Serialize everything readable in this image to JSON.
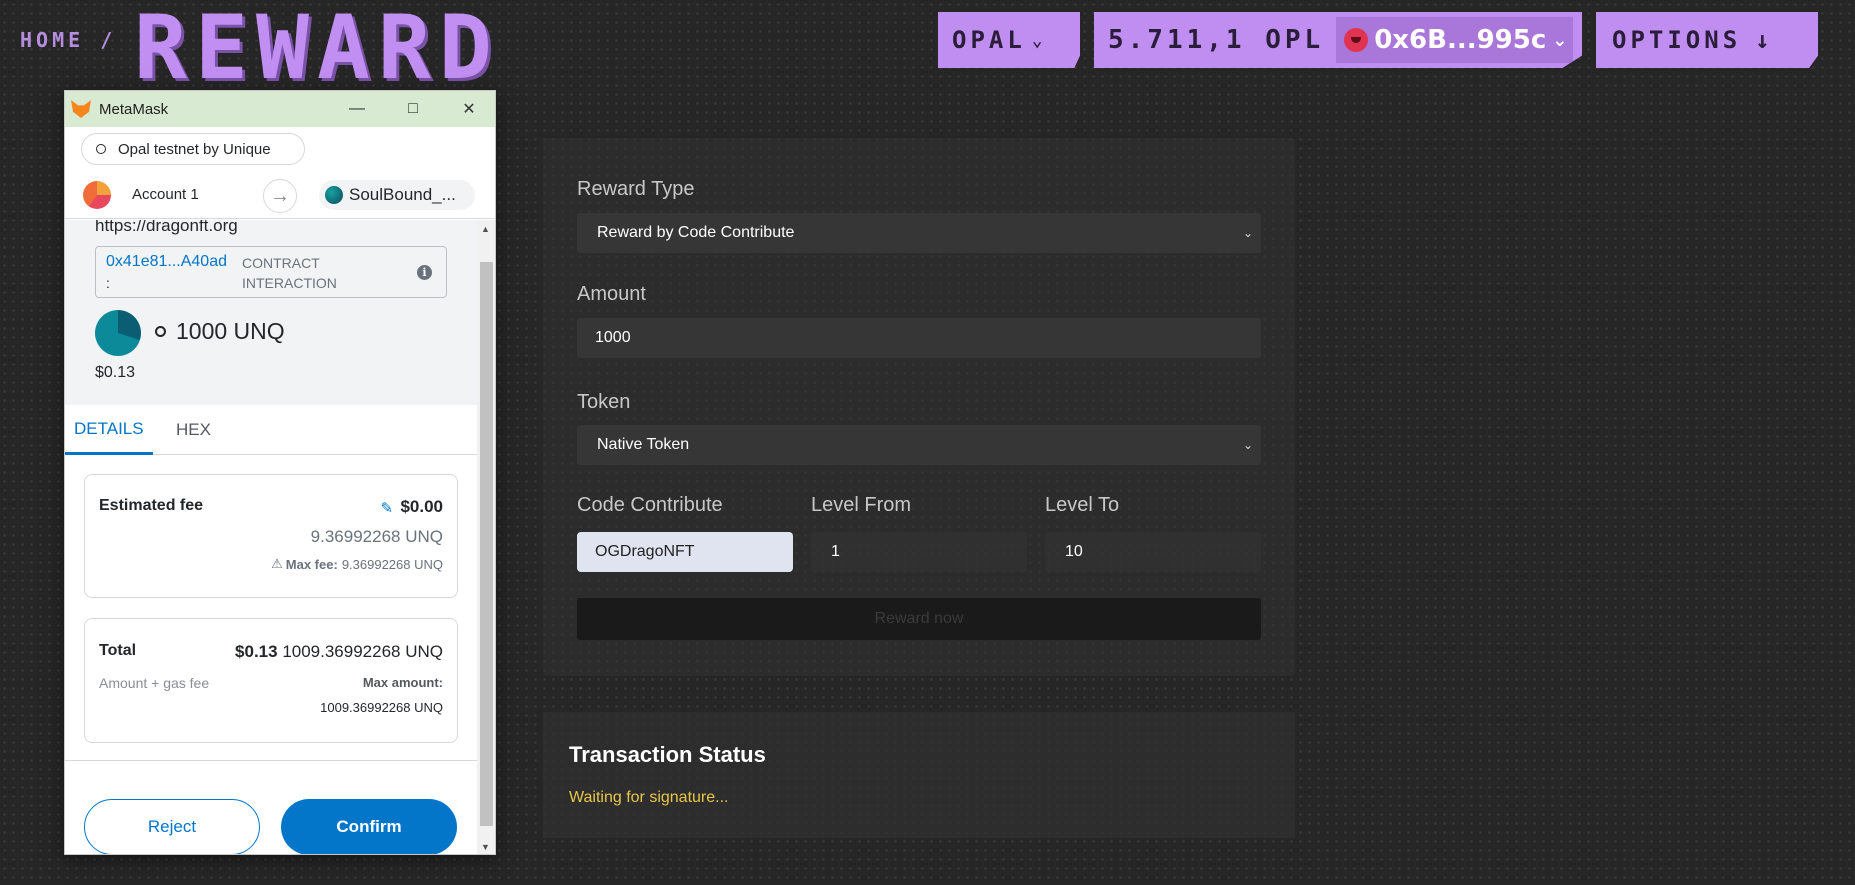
{
  "header": {
    "breadcrumb": "HOME /",
    "title": "REWARD",
    "network_label": "OPAL",
    "balance": "5.711,1 OPL",
    "account_short": "0x6B...995c",
    "options_label": "OPTIONS"
  },
  "form": {
    "reward_type_label": "Reward Type",
    "reward_type_value": "Reward by Code Contribute",
    "amount_label": "Amount",
    "amount_value": "1000",
    "token_label": "Token",
    "token_value": "Native Token",
    "code_contribute_label": "Code Contribute",
    "code_contribute_value": "OGDragoNFT",
    "level_from_label": "Level From",
    "level_from_value": "1",
    "level_to_label": "Level To",
    "level_to_value": "10",
    "submit_label": "Reward now"
  },
  "status": {
    "title": "Transaction Status",
    "message": "Waiting for signature..."
  },
  "metamask": {
    "window_title": "MetaMask",
    "network": "Opal testnet by Unique",
    "account": "Account 1",
    "contract_name": "SoulBound_...",
    "site": "https://dragonft.org",
    "contract_address": "0x41e81...A40ad",
    "contract_colon": ":",
    "contract_interaction": "CONTRACT INTERACTION",
    "amount": "1000 UNQ",
    "amount_fiat": "$0.13",
    "tabs": [
      "DETAILS",
      "HEX"
    ],
    "fee": {
      "label": "Estimated fee",
      "fiat": "$0.00",
      "native": "9.36992268 UNQ",
      "max_label": "Max fee:",
      "max_value": "9.36992268 UNQ"
    },
    "total": {
      "label": "Total",
      "fiat": "$0.13",
      "native": "1009.36992268 UNQ",
      "sub_label": "Amount + gas fee",
      "max_label": "Max amount:",
      "max_value": "1009.36992268 UNQ"
    },
    "reject_label": "Reject",
    "confirm_label": "Confirm"
  },
  "colors": {
    "accent_purple": "#c08ef0",
    "metamask_blue": "#0376c9",
    "status_yellow": "#e8c64a"
  }
}
